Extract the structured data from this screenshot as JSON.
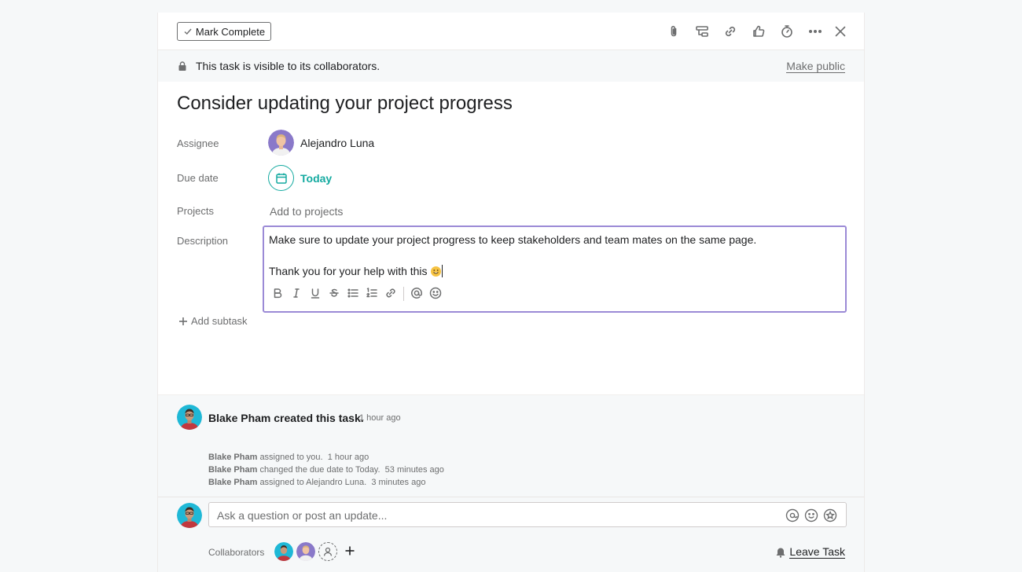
{
  "toolbar": {
    "mark_complete_label": "Mark Complete"
  },
  "privacy": {
    "text": "This task is visible to its collaborators.",
    "make_public_label": "Make public"
  },
  "task": {
    "title": "Consider updating your project progress",
    "fields": {
      "assignee_label": "Assignee",
      "assignee_name": "Alejandro Luna",
      "due_date_label": "Due date",
      "due_date_value": "Today",
      "projects_label": "Projects",
      "projects_placeholder": "Add to projects",
      "description_label": "Description"
    },
    "description": {
      "line1": "Make sure to update your project progress to keep stakeholders and team mates on the same page.",
      "line2": "Thank you for your help with this"
    },
    "add_subtask_label": "Add subtask"
  },
  "activity": {
    "creator_line": "Blake Pham created this task.",
    "creator_time": "1 hour ago",
    "stories": [
      {
        "actor": "Blake Pham",
        "action": "assigned to you.",
        "time": "1 hour ago"
      },
      {
        "actor": "Blake Pham",
        "action": "changed the due date to Today.",
        "time": "53 minutes ago"
      },
      {
        "actor": "Blake Pham",
        "action": "assigned to Alejandro Luna.",
        "time": "3 minutes ago"
      }
    ]
  },
  "comment": {
    "placeholder": "Ask a question or post an update..."
  },
  "collaborators": {
    "label": "Collaborators",
    "leave_label": "Leave Task"
  },
  "colors": {
    "accent_teal": "#14aaa0",
    "focus_purple": "#9b8ad6",
    "avatar_blake_bg": "#1fb8d6",
    "avatar_alejandro_bg": "#8a79c9"
  }
}
